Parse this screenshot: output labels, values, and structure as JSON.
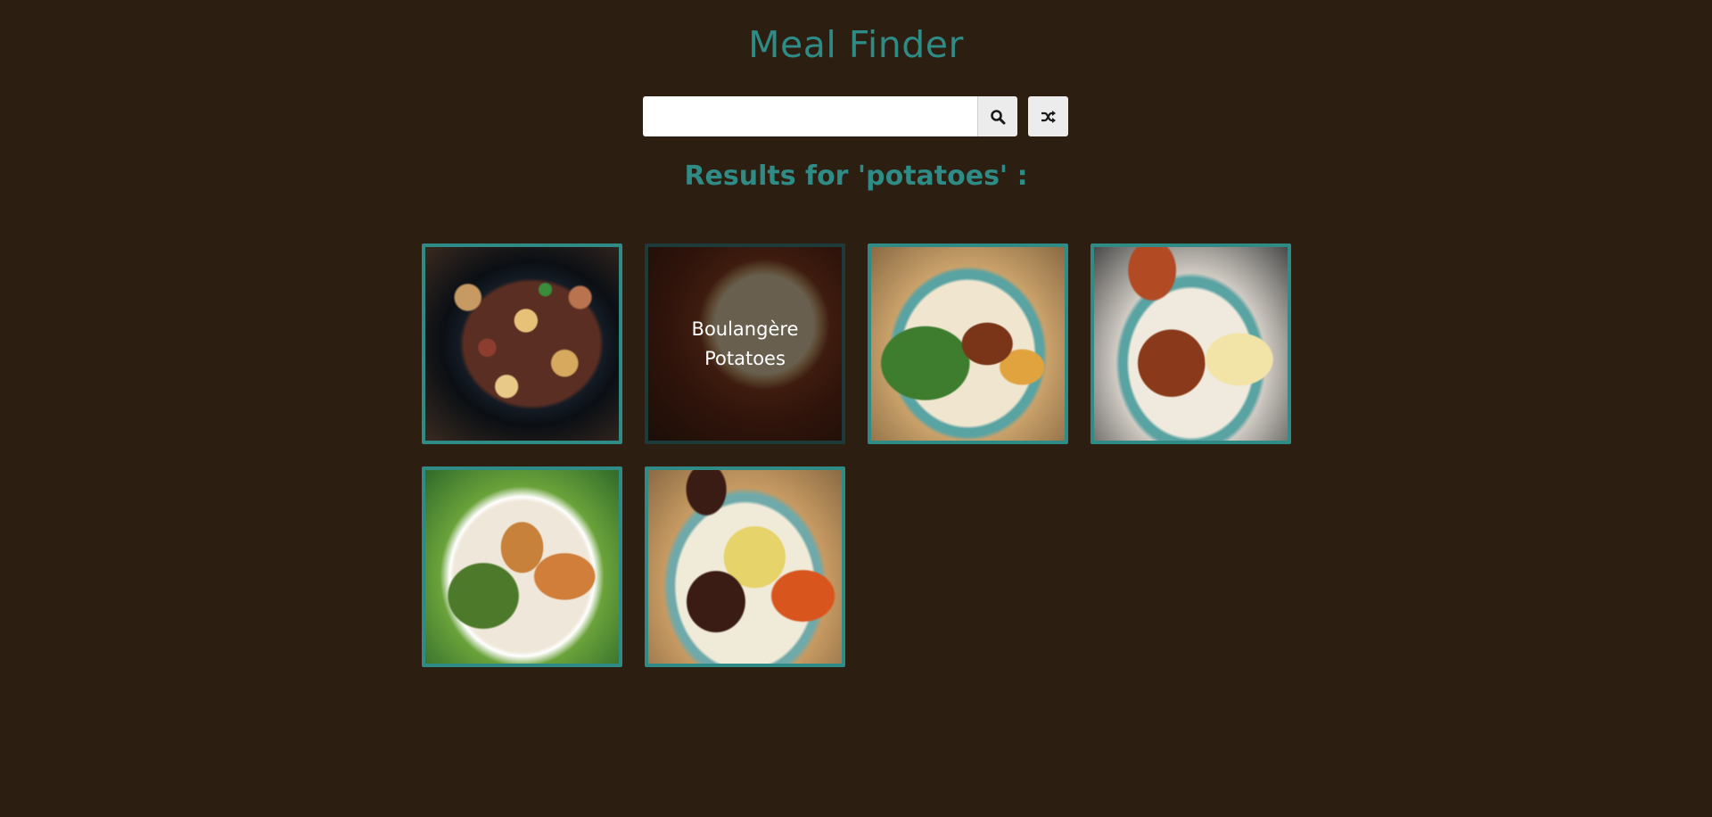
{
  "app": {
    "title": "Meal Finder"
  },
  "search": {
    "value": "",
    "placeholder": "",
    "search_icon": "search-icon",
    "random_icon": "shuffle-icon"
  },
  "results": {
    "heading": "Results for 'potatoes' :",
    "meals": [
      {
        "name": "",
        "show_name": false
      },
      {
        "name": "Boulangère Potatoes",
        "show_name": true
      },
      {
        "name": "",
        "show_name": false
      },
      {
        "name": "",
        "show_name": false
      },
      {
        "name": "",
        "show_name": false
      },
      {
        "name": "",
        "show_name": false
      }
    ]
  },
  "colors": {
    "background": "#2d1e12",
    "accent": "#2e8b85",
    "button": "#ececec"
  }
}
